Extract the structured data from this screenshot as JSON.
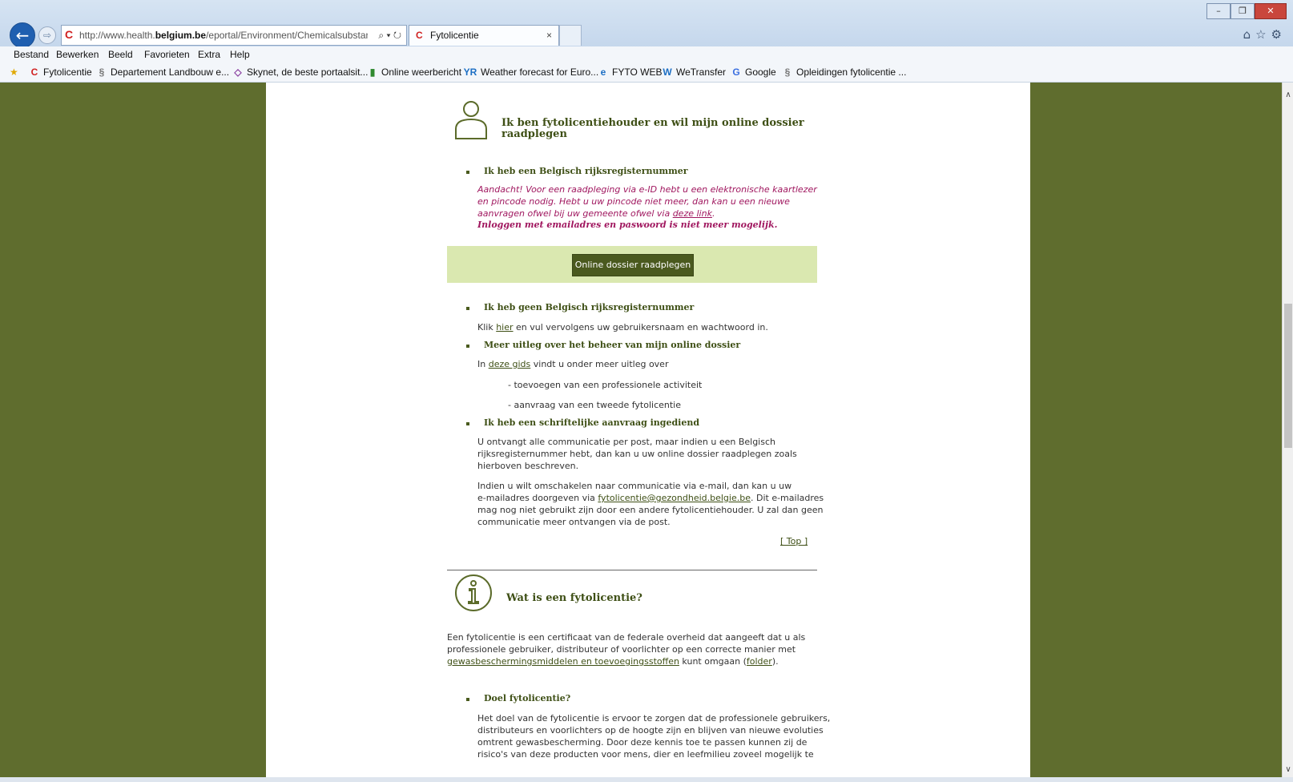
{
  "browser": {
    "url_prefix": "http://www.health.",
    "url_domain": "belgium.be",
    "url_suffix": "/eportal/Environment/Chemicalsubstance:",
    "tab_title": "Fytolicentie",
    "tab_close": "×"
  },
  "menu": [
    "Bestand",
    "Bewerken",
    "Beeld",
    "Favorieten",
    "Extra",
    "Help"
  ],
  "favorites": [
    {
      "label": "Fytolicentie",
      "icon": "C"
    },
    {
      "label": "Departement Landbouw e...",
      "icon": "§"
    },
    {
      "label": "Skynet, de beste portaalsit...",
      "icon": "◇"
    },
    {
      "label": "Online weerbericht",
      "icon": "▮"
    },
    {
      "label": "Weather forecast for Euro...",
      "icon": "YR"
    },
    {
      "label": "FYTO WEB",
      "icon": "e"
    },
    {
      "label": "WeTransfer",
      "icon": "W"
    },
    {
      "label": "Google",
      "icon": "G"
    },
    {
      "label": "Opleidingen fytolicentie ...",
      "icon": "§"
    }
  ],
  "section1": {
    "title_line1": "Ik ben fytolicentiehouder en wil mijn online dossier",
    "title_line2": "raadplegen",
    "item1_title": "Ik heb een Belgisch rijksregisternummer",
    "warn_line1": "Aandacht! Voor een raadpleging via e-ID hebt u een elektronische kaartlezer",
    "warn_line2": "en pincode nodig. Hebt u uw pincode niet meer, dan kan u een nieuwe",
    "warn_line3_pre": "aanvragen ofwel bij uw gemeente ofwel via ",
    "warn_line3_link": "deze link",
    "warn_line3_post": ".",
    "warn_bold": "Inloggen met emailadres en paswoord is niet meer mogelijk.",
    "button": "Online dossier raadplegen",
    "item2_title": "Ik heb geen Belgisch rijksregisternummer",
    "item2_pre": "Klik ",
    "item2_link": "hier",
    "item2_post": " en vul vervolgens uw gebruikersnaam en wachtwoord in.",
    "item3_title": "Meer uitleg over het beheer van mijn online dossier",
    "item3_pre": "In ",
    "item3_link": "deze gids",
    "item3_post": " vindt u onder meer uitleg over",
    "item3_sub1": "- toevoegen van een professionele activiteit",
    "item3_sub2": "- aanvraag van een tweede fytolicentie",
    "item4_title": "Ik heb een schriftelijke aanvraag ingediend",
    "item4_p1_l1": "U ontvangt alle communicatie per post, maar indien u een Belgisch",
    "item4_p1_l2": "rijksregisternummer hebt, dan kan u uw online dossier raadplegen zoals",
    "item4_p1_l3": "hierboven beschreven.",
    "item4_p2_l1": "Indien u wilt omschakelen naar communicatie via e-mail, dan kan u uw",
    "item4_p2_l2_pre": "e-mailadres doorgeven via ",
    "item4_p2_l2_link": "fytolicentie@gezondheid.belgie.be",
    "item4_p2_l2_post": ". Dit e-mailadres",
    "item4_p2_l3": "mag nog niet gebruikt zijn door een andere fytolicentiehouder. U zal dan geen",
    "item4_p2_l4": "communicatie meer ontvangen via de post.",
    "top_link": "[ Top ]"
  },
  "section2": {
    "title": "Wat is een fytolicentie?",
    "p_l1": "Een fytolicentie is een certificaat van de federale overheid dat aangeeft dat u als",
    "p_l2": "professionele gebruiker, distributeur of voorlichter op een correcte manier met",
    "p_l3_link1": "gewasbeschermingsmiddelen en toevoegingsstoffen",
    "p_l3_mid": " kunt omgaan (",
    "p_l3_link2": "folder",
    "p_l3_post": ").",
    "doel_title": "Doel fytolicentie?",
    "doel_l1": "Het doel van de fytolicentie is ervoor te zorgen dat de professionele gebruikers,",
    "doel_l2": "distributeurs en voorlichters op de hoogte zijn en blijven van nieuwe evoluties",
    "doel_l3": "omtrent gewasbescherming. Door deze kennis toe te passen kunnen zij  de",
    "doel_l4": "risico's van deze producten voor mens, dier en leefmilieu zoveel mogelijk te"
  },
  "colors": {
    "olive_bg": "#5f6d2e",
    "heading": "#3e4f15",
    "warning": "#a0175f",
    "band": "#dae8b0",
    "button": "#4a591e"
  }
}
